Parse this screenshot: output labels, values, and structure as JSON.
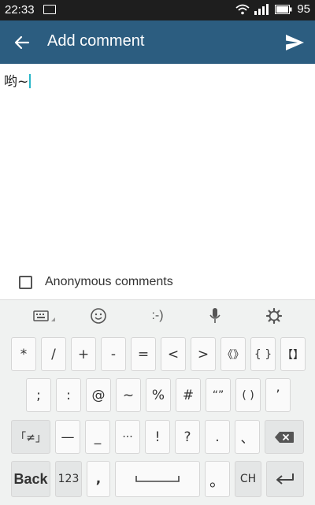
{
  "status": {
    "time": "22:33",
    "battery": "95"
  },
  "appbar": {
    "title": "Add comment"
  },
  "editor": {
    "text": "哟~"
  },
  "anonymous": {
    "label": "Anonymous comments",
    "checked": false
  },
  "keyboard": {
    "emoticon": ":-)",
    "row1": [
      "*",
      "/",
      "+",
      "-",
      "=",
      "<",
      ">",
      "《》",
      "{ }",
      "【】"
    ],
    "row2": [
      ";",
      ":",
      "@",
      "~",
      "%",
      "#",
      "“”",
      "( )",
      "’"
    ],
    "row3": [
      "「≠」",
      "—",
      "_",
      "···",
      "!",
      "?",
      ".",
      "、"
    ],
    "back": "Back",
    "numbers": "123",
    "comma": ",",
    "period": "。",
    "lang": "CH"
  }
}
